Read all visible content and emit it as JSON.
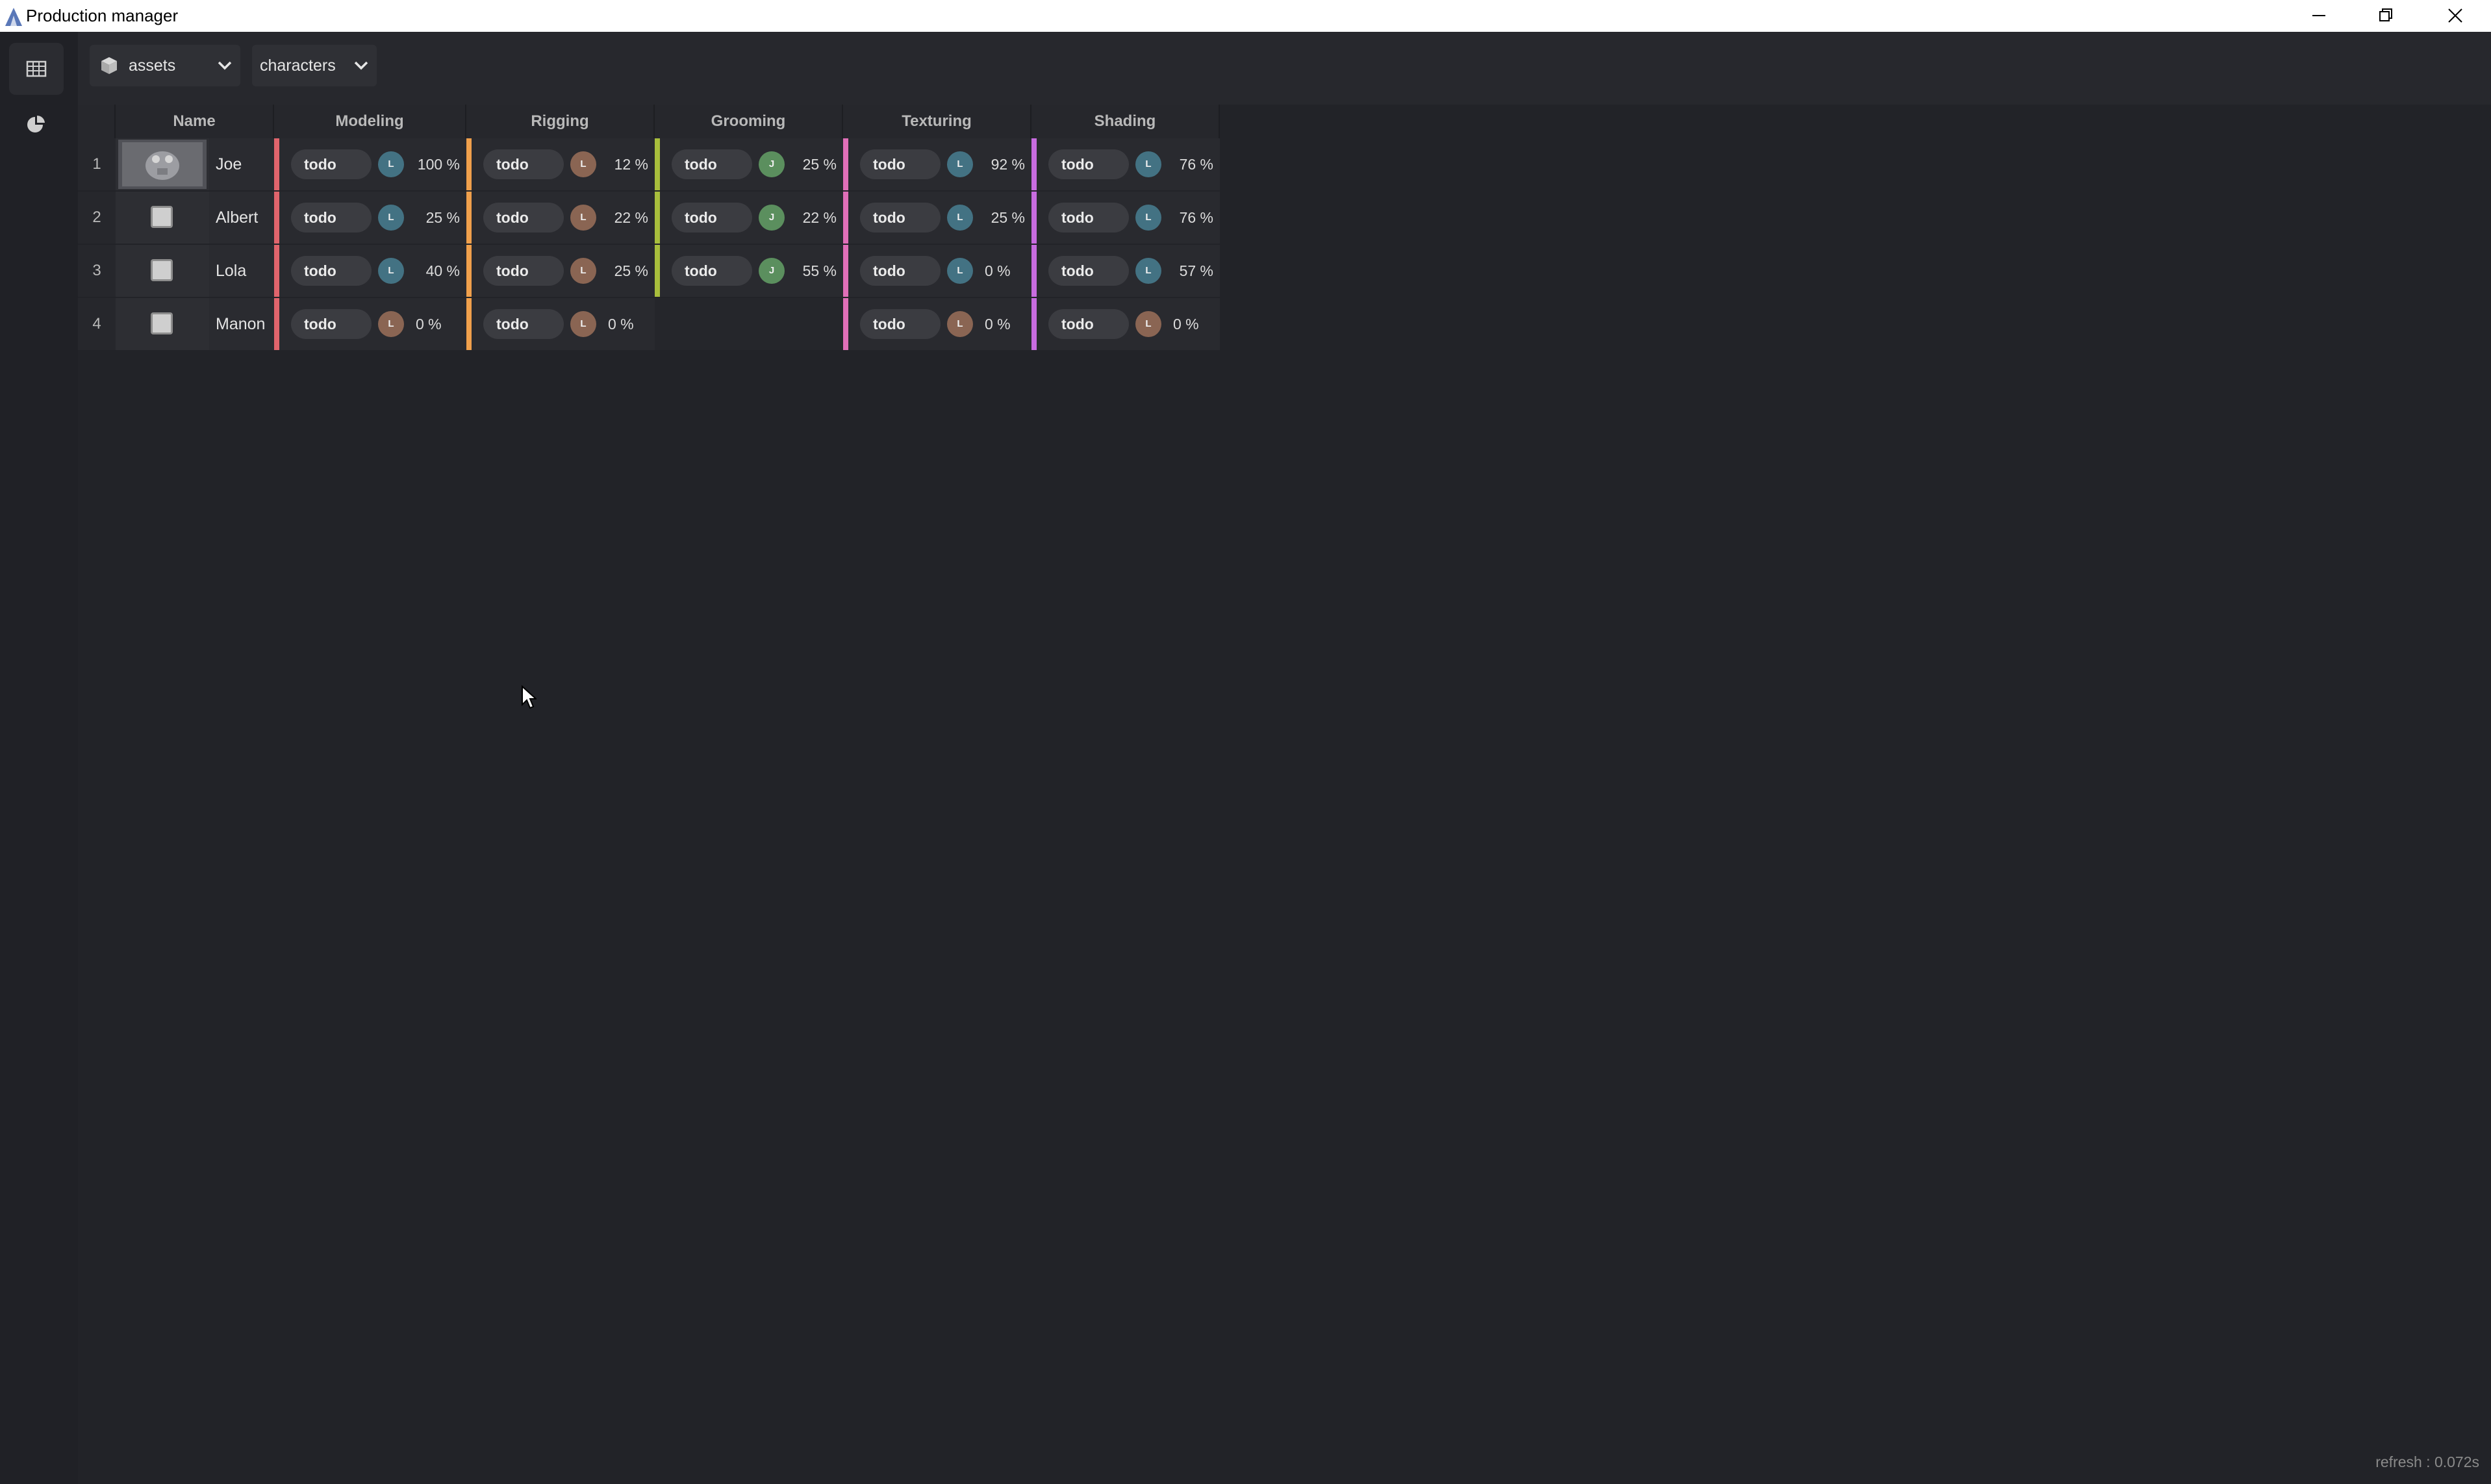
{
  "window": {
    "title": "Production manager"
  },
  "toolbar": {
    "type_dropdown": "assets",
    "category_dropdown": "characters"
  },
  "table": {
    "columns": [
      "Name",
      "Modeling",
      "Rigging",
      "Grooming",
      "Texturing",
      "Shading"
    ],
    "rows": [
      {
        "num": "1",
        "name": "Joe",
        "tasks": [
          {
            "status": "todo",
            "user": "L",
            "progress": "100 %"
          },
          {
            "status": "todo",
            "user": "L",
            "progress": "12 %"
          },
          {
            "status": "todo",
            "user": "J",
            "progress": "25 %"
          },
          {
            "status": "todo",
            "user": "L",
            "progress": "92 %"
          },
          {
            "status": "todo",
            "user": "L",
            "progress": "76 %"
          }
        ]
      },
      {
        "num": "2",
        "name": "Albert",
        "tasks": [
          {
            "status": "todo",
            "user": "L",
            "progress": "25 %"
          },
          {
            "status": "todo",
            "user": "L",
            "progress": "22 %"
          },
          {
            "status": "todo",
            "user": "J",
            "progress": "22 %"
          },
          {
            "status": "todo",
            "user": "L",
            "progress": "25 %"
          },
          {
            "status": "todo",
            "user": "L",
            "progress": "76 %"
          }
        ]
      },
      {
        "num": "3",
        "name": "Lola",
        "tasks": [
          {
            "status": "todo",
            "user": "L",
            "progress": "40 %"
          },
          {
            "status": "todo",
            "user": "L",
            "progress": "25 %"
          },
          {
            "status": "todo",
            "user": "J",
            "progress": "55 %"
          },
          {
            "status": "todo",
            "user": "L",
            "progress": "0 %"
          },
          {
            "status": "todo",
            "user": "L",
            "progress": "57 %"
          }
        ]
      },
      {
        "num": "4",
        "name": "Manon",
        "tasks": [
          {
            "status": "todo",
            "user": "L",
            "progress": "0 %"
          },
          {
            "status": "todo",
            "user": "L",
            "progress": "0 %"
          },
          null,
          {
            "status": "todo",
            "user": "L",
            "progress": "0 %"
          },
          {
            "status": "todo",
            "user": "L",
            "progress": "0 %"
          }
        ]
      }
    ]
  },
  "colors": {
    "modeling": "#e0646c",
    "rigging": "#f0a04c",
    "grooming": "#a8be3c",
    "texturing": "#e06fb8",
    "shading": "#c86ce0"
  },
  "footer": {
    "refresh": "refresh : 0.072s"
  }
}
